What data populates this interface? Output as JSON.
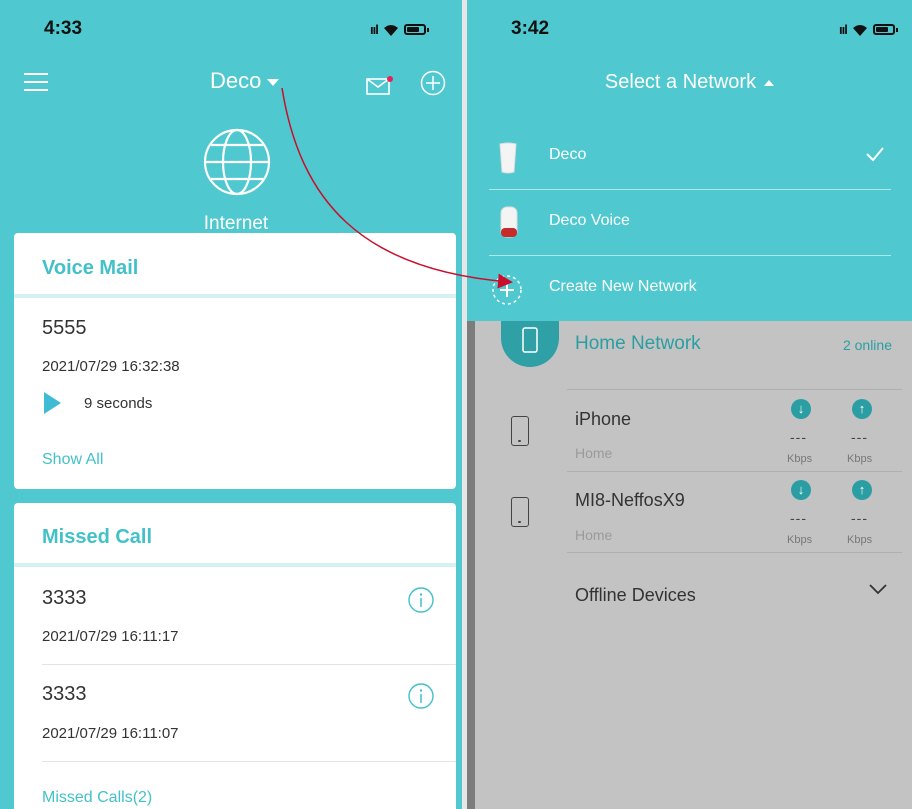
{
  "left_screen": {
    "status": {
      "time": "4:33"
    },
    "header": {
      "title": "Deco"
    },
    "internet_label": "Internet",
    "voicemail": {
      "title": "Voice Mail",
      "number": "5555",
      "datetime": "2021/07/29 16:32:38",
      "duration": "9 seconds",
      "show_all": "Show All"
    },
    "missed_call": {
      "title": "Missed Call",
      "calls": [
        {
          "number": "3333",
          "datetime": "2021/07/29 16:11:17"
        },
        {
          "number": "3333",
          "datetime": "2021/07/29 16:11:07"
        }
      ],
      "link": "Missed Calls(2)"
    }
  },
  "right_screen": {
    "status": {
      "time": "3:42"
    },
    "select_title": "Select a Network",
    "networks": [
      {
        "label": "Deco",
        "selected": true
      },
      {
        "label": "Deco Voice",
        "selected": false
      },
      {
        "label": "Create New Network",
        "selected": false
      }
    ],
    "background": {
      "network": "Home Network",
      "online": "2 online",
      "devices": [
        {
          "name": "iPhone",
          "sub": "Home",
          "down": "---",
          "up": "---",
          "unit": "Kbps"
        },
        {
          "name": "MI8-NeffosX9",
          "sub": "Home",
          "down": "---",
          "up": "---",
          "unit": "Kbps"
        }
      ],
      "offline": "Offline Devices"
    }
  },
  "colors": {
    "teal": "#4fc9cf",
    "accent_text": "#43c1c8",
    "red_arrow": "#c8102e"
  }
}
